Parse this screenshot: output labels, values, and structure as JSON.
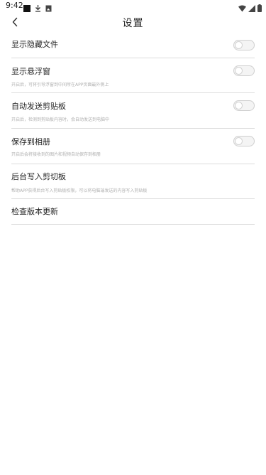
{
  "status_bar": {
    "time": "9:42",
    "left_icons": [
      "square-icon",
      "download-icon",
      "image-icon"
    ],
    "right_icons": [
      "wifi-icon",
      "signal-icon",
      "battery-icon"
    ]
  },
  "header": {
    "title": "设置",
    "back_icon": "chevron-left-icon"
  },
  "settings": {
    "show_hidden_files": {
      "label": "显示隐藏文件",
      "enabled": false
    },
    "floating_window": {
      "label": "显示悬浮窗",
      "description": "开启后，可将引导浮窗到中间所在APP页面最外侧上",
      "enabled": false
    },
    "auto_send_clipboard": {
      "label": "自动发送剪贴板",
      "description": "开启后，检测到剪贴板内容时，会自动发送到电脑中",
      "enabled": false
    },
    "save_to_album": {
      "label": "保存到相册",
      "description": "开启后会将接收到的图片和视频自动保存到相册",
      "enabled": false
    },
    "background_clipboard": {
      "label": "后台写入剪切板",
      "description": "帮助APP获得后台写入剪贴板权限，可以将电脑端发送的内容写入剪贴板"
    },
    "check_update": {
      "label": "检查版本更新"
    }
  },
  "colors": {
    "background": "#ffffff",
    "divider": "#dcdcdc",
    "text": "#222222",
    "description_text": "#b0b0b0",
    "toggle_off_track": "#f4f4f4"
  }
}
